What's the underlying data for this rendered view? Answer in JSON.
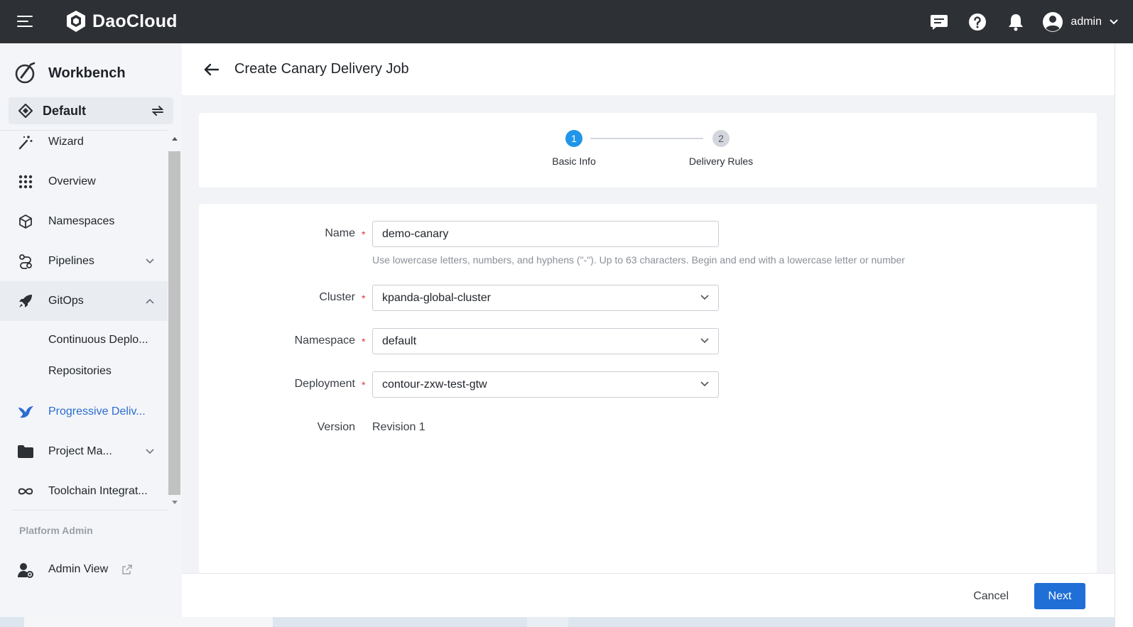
{
  "topbar": {
    "brand": "DaoCloud",
    "user": "admin",
    "icons": [
      "message-icon",
      "help-icon",
      "bell-icon",
      "user-avatar-icon"
    ]
  },
  "sidebar": {
    "title": "Workbench",
    "workspace": "Default",
    "menu": {
      "wizard": "Wizard",
      "overview": "Overview",
      "namespaces": "Namespaces",
      "pipelines": "Pipelines",
      "gitops": "GitOps",
      "continuous_deploy": "Continuous Deplo...",
      "repositories": "Repositories",
      "progressive_delivery": "Progressive Deliv...",
      "project_management": "Project Ma...",
      "toolchain": "Toolchain Integrat..."
    },
    "platform_admin": "Platform Admin",
    "admin_view": "Admin View"
  },
  "page": {
    "title": "Create Canary Delivery Job"
  },
  "steps": [
    {
      "number": "1",
      "label": "Basic Info",
      "state": "active"
    },
    {
      "number": "2",
      "label": "Delivery Rules",
      "state": "pending"
    }
  ],
  "form": {
    "name": {
      "label": "Name",
      "value": "demo-canary",
      "hint": "Use lowercase letters, numbers, and hyphens (\"-\"). Up to 63 characters. Begin and end with a lowercase letter or number"
    },
    "cluster": {
      "label": "Cluster",
      "value": "kpanda-global-cluster"
    },
    "namespace": {
      "label": "Namespace",
      "value": "default"
    },
    "deployment": {
      "label": "Deployment",
      "value": "contour-zxw-test-gtw"
    },
    "version": {
      "label": "Version",
      "value": "Revision 1"
    },
    "required_mark": "*"
  },
  "footer": {
    "cancel": "Cancel",
    "next": "Next"
  },
  "colors": {
    "topbar": "#2d3035",
    "primary": "#1f6fd6",
    "active_menu_text": "#2b6ccf",
    "step_active": "#2196e8",
    "step_pending": "#d3d7dd"
  }
}
